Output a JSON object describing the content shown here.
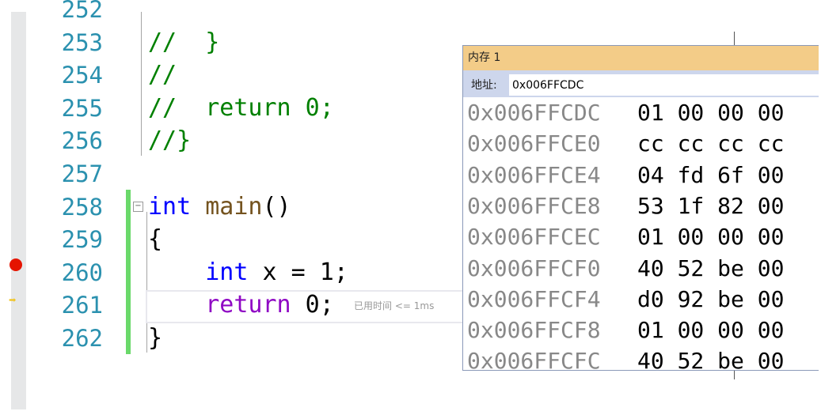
{
  "editor": {
    "lines": [
      {
        "num": "252",
        "parts": []
      },
      {
        "num": "253",
        "parts": [
          {
            "t": "//  }",
            "c": "cm"
          }
        ]
      },
      {
        "num": "254",
        "parts": [
          {
            "t": "//",
            "c": "cm"
          }
        ]
      },
      {
        "num": "255",
        "parts": [
          {
            "t": "//  return 0;",
            "c": "cm"
          }
        ]
      },
      {
        "num": "256",
        "parts": [
          {
            "t": "//}",
            "c": "cm"
          }
        ]
      },
      {
        "num": "257",
        "parts": []
      },
      {
        "num": "258",
        "parts": [
          {
            "t": "int",
            "c": "kw"
          },
          {
            "t": " ",
            "c": "pl"
          },
          {
            "t": "main",
            "c": "fn"
          },
          {
            "t": "()",
            "c": "pl"
          }
        ]
      },
      {
        "num": "259",
        "parts": [
          {
            "t": "{",
            "c": "pl"
          }
        ]
      },
      {
        "num": "260",
        "parts": [
          {
            "t": "    ",
            "c": "pl"
          },
          {
            "t": "int",
            "c": "kw"
          },
          {
            "t": " x = 1;",
            "c": "pl"
          }
        ]
      },
      {
        "num": "261",
        "parts": [
          {
            "t": "    ",
            "c": "pl"
          },
          {
            "t": "return",
            "c": "ret"
          },
          {
            "t": " 0;",
            "c": "pl"
          }
        ]
      },
      {
        "num": "262",
        "parts": [
          {
            "t": "}",
            "c": "pl"
          }
        ]
      }
    ],
    "fold_glyph": "−",
    "timing_hint": "已用时间 <= 1ms",
    "breakpoint_line": "260",
    "current_line": "261"
  },
  "memory": {
    "title": "内存 1",
    "address_label": "地址:",
    "address_value": "0x006FFCDC",
    "rows": [
      {
        "addr": "0x006FFCDC",
        "bytes": "01 00 00 00"
      },
      {
        "addr": "0x006FFCE0",
        "bytes": "cc cc cc cc"
      },
      {
        "addr": "0x006FFCE4",
        "bytes": "04 fd 6f 00"
      },
      {
        "addr": "0x006FFCE8",
        "bytes": "53 1f 82 00"
      },
      {
        "addr": "0x006FFCEC",
        "bytes": "01 00 00 00"
      },
      {
        "addr": "0x006FFCF0",
        "bytes": "40 52 be 00"
      },
      {
        "addr": "0x006FFCF4",
        "bytes": "d0 92 be 00"
      },
      {
        "addr": "0x006FFCF8",
        "bytes": "01 00 00 00"
      },
      {
        "addr": "0x006FFCFC",
        "bytes": "40 52 be 00"
      }
    ]
  },
  "colors": {
    "breakpoint": "#e51400",
    "title_bar": "#f3cc88",
    "change_bar": "#6ad96a"
  }
}
